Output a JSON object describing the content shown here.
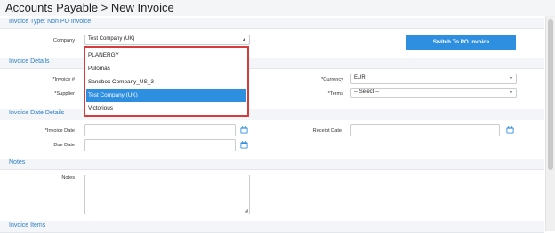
{
  "page": {
    "title": "Accounts Payable > New Invoice"
  },
  "invoice_type": {
    "title": "Invoice Type: Non PO Invoice",
    "company_label": "Company",
    "company_value": "Test Company (UK)",
    "switch_button": "Switch To PO Invoice",
    "company_options": [
      "PLANERGY",
      "Pulomas",
      "Sandbox Company_US_3",
      "Test Company (UK)",
      "Victorious"
    ],
    "selected_option": "Test Company (UK)"
  },
  "invoice_details": {
    "title": "Invoice Details",
    "invoice_no_label": "*Invoice #",
    "supplier_label": "*Supplier",
    "currency_label": "*Currency",
    "currency_value": "EUR",
    "terms_label": "*Terms",
    "terms_value": "-- Select --"
  },
  "date_details": {
    "title": "Invoice Date Details",
    "invoice_date_label": "*Invoice Date",
    "receipt_date_label": "Receipt Date",
    "due_date_label": "Due Date"
  },
  "notes": {
    "title": "Notes",
    "notes_label": "Notes"
  },
  "invoice_items": {
    "title": "Invoice Items"
  },
  "colors": {
    "accent": "#2e8ee0",
    "section_title": "#2b7fc3",
    "highlight": "#d73b3b"
  },
  "icons": {
    "calendar": "calendar-icon",
    "dropdown": "chevron-down-icon"
  }
}
